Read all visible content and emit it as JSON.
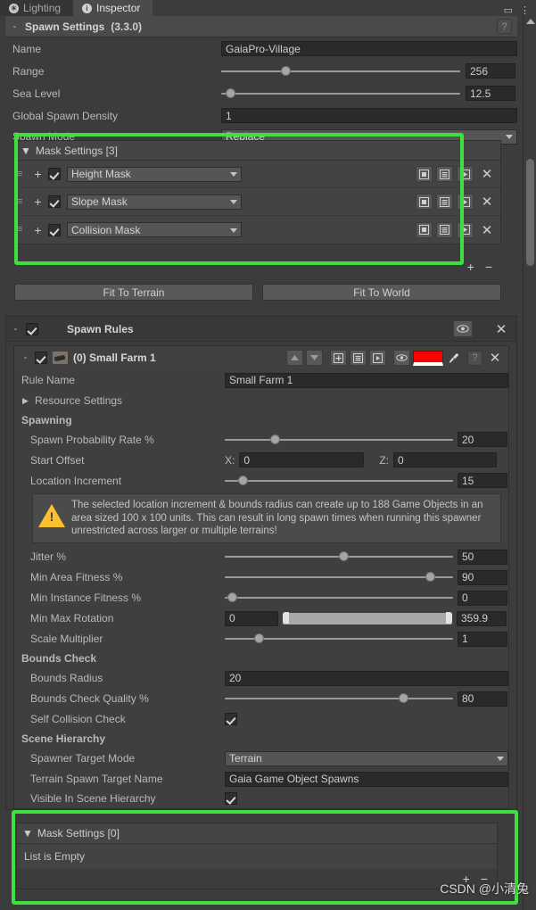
{
  "window": {
    "tabs": [
      {
        "label": "Lighting",
        "icon": "lighting-icon",
        "active": false
      },
      {
        "label": "Inspector",
        "icon": "info-icon",
        "active": true
      }
    ],
    "controls": [
      "maximize-icon",
      "more-menu-icon"
    ]
  },
  "spawn_settings": {
    "fold": "-",
    "title": "Spawn Settings",
    "version": "(3.3.0)",
    "help": "?",
    "fields": [
      {
        "label": "Name",
        "type": "text",
        "value": "GaiaPro-Village"
      },
      {
        "label": "Range",
        "type": "slider",
        "value": "256",
        "knob_pct": 25
      },
      {
        "label": "Sea Level",
        "type": "slider",
        "value": "12.5",
        "knob_pct": 2
      },
      {
        "label": "Global Spawn Density",
        "type": "text",
        "value": "1"
      },
      {
        "label": "Spawn Mode",
        "type": "dropdown",
        "value": "Replace"
      }
    ],
    "mask_settings": {
      "fold": "▼",
      "title": "Mask Settings [3]",
      "rows": [
        {
          "plus": "+",
          "checked": true,
          "name": "Height Mask"
        },
        {
          "plus": "+",
          "checked": true,
          "name": "Slope Mask"
        },
        {
          "plus": "+",
          "checked": true,
          "name": "Collision Mask"
        }
      ],
      "row_icons": [
        "save-icon",
        "list-icon",
        "play-icon"
      ],
      "row_close": "✕",
      "footer": {
        "add": "+",
        "remove": "−"
      }
    },
    "buttons": [
      {
        "label": "Fit To Terrain"
      },
      {
        "label": "Fit To World"
      }
    ]
  },
  "spawn_rules": {
    "fold": "-",
    "checked": true,
    "title": "Spawn Rules",
    "eye": "eye-icon",
    "close": "✕",
    "rule": {
      "fold": "-",
      "checked": true,
      "thumbnail": "farm-thumbnail-icon",
      "title": "(0) Small Farm 1",
      "icons": [
        "move-up-icon",
        "move-down-icon",
        "add-icon",
        "list-icon",
        "play-icon",
        "eye-icon"
      ],
      "color": "#ff0000",
      "eyedropper": "eyedropper-icon",
      "help": "?",
      "close": "✕",
      "rule_name_label": "Rule Name",
      "rule_name_value": "Small Farm 1",
      "resource_settings_label": "Resource Settings",
      "resource_settings_fold": "▶",
      "sections": [
        {
          "title": "Spawning",
          "fields": [
            {
              "label": "Spawn Probability Rate %",
              "type": "slider",
              "value": "20",
              "knob_pct": 20
            },
            {
              "label": "Start Offset",
              "type": "vector2",
              "x_label": "X:",
              "x_value": "0",
              "z_label": "Z:",
              "z_value": "0"
            },
            {
              "label": "Location Increment",
              "type": "slider",
              "value": "15",
              "knob_pct": 6
            }
          ],
          "warning": "The selected location increment & bounds radius can create up to 188 Game Objects in an area sized 100 x 100 units. This can result in long spawn times when running this spawner unrestricted across larger or multiple terrains!",
          "fields_after": [
            {
              "label": "Jitter %",
              "type": "slider",
              "value": "50",
              "knob_pct": 50
            },
            {
              "label": "Min Area Fitness %",
              "type": "slider",
              "value": "90",
              "knob_pct": 90
            },
            {
              "label": "Min Instance Fitness %",
              "type": "slider",
              "value": "0",
              "knob_pct": 2
            },
            {
              "label": "Min Max Rotation",
              "type": "range",
              "min_value": "0",
              "max_value": "359.9"
            },
            {
              "label": "Scale Multiplier",
              "type": "slider",
              "value": "1",
              "knob_pct": 14
            }
          ]
        },
        {
          "title": "Bounds Check",
          "fields": [
            {
              "label": "Bounds Radius",
              "type": "text",
              "value": "20"
            },
            {
              "label": "Bounds Check Quality %",
              "type": "slider",
              "value": "80",
              "knob_pct": 78
            },
            {
              "label": "Self Collision Check",
              "type": "checkbox",
              "checked": true
            }
          ]
        },
        {
          "title": "Scene Hierarchy",
          "fields": [
            {
              "label": "Spawner Target Mode",
              "type": "dropdown",
              "value": "Terrain"
            },
            {
              "label": "Terrain Spawn Target Name",
              "type": "text",
              "value": "Gaia Game Object Spawns"
            },
            {
              "label": "Visible In Scene Hierarchy",
              "type": "checkbox",
              "checked": true
            }
          ]
        }
      ],
      "mask_settings": {
        "fold": "▼",
        "title": "Mask Settings [0]",
        "empty_text": "List is Empty",
        "footer": {
          "add": "+",
          "remove": "−"
        }
      }
    }
  },
  "watermark": "CSDN @小清兔",
  "colors": {
    "annotation": "#3ee03e",
    "panel_bg": "#3c3c3c",
    "header_bg": "#4a4a4a",
    "field_bg": "#2a2a2a",
    "rule_color": "#ff0000"
  }
}
